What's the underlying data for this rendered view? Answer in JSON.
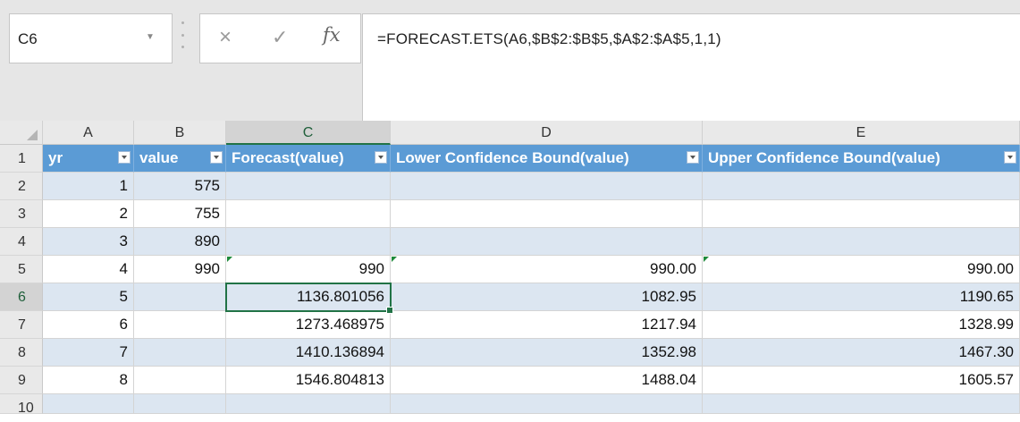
{
  "name_box": {
    "value": "C6"
  },
  "formula_bar": {
    "cancel_icon": "×",
    "enter_icon": "✓",
    "fx_label": "fx",
    "formula": "=FORECAST.ETS(A6,$B$2:$B$5,$A$2:$A$5,1,1)"
  },
  "grid": {
    "columns": [
      "A",
      "B",
      "C",
      "D",
      "E"
    ],
    "selected_column": "C",
    "header_row": {
      "number": "1",
      "cells": [
        "yr",
        "value",
        "Forecast(value)",
        "Lower Confidence Bound(value)",
        "Upper Confidence Bound(value)"
      ]
    },
    "rows": [
      {
        "number": "2",
        "cells": [
          "1",
          "575",
          "",
          "",
          ""
        ]
      },
      {
        "number": "3",
        "cells": [
          "2",
          "755",
          "",
          "",
          ""
        ]
      },
      {
        "number": "4",
        "cells": [
          "3",
          "890",
          "",
          "",
          ""
        ]
      },
      {
        "number": "5",
        "cells": [
          "4",
          "990",
          "990",
          "990.00",
          "990.00"
        ]
      },
      {
        "number": "6",
        "cells": [
          "5",
          "",
          "1136.801056",
          "1082.95",
          "1190.65"
        ]
      },
      {
        "number": "7",
        "cells": [
          "6",
          "",
          "1273.468975",
          "1217.94",
          "1328.99"
        ]
      },
      {
        "number": "8",
        "cells": [
          "7",
          "",
          "1410.136894",
          "1352.98",
          "1467.30"
        ]
      },
      {
        "number": "9",
        "cells": [
          "8",
          "",
          "1546.804813",
          "1488.04",
          "1605.57"
        ]
      },
      {
        "number": "10",
        "cells": [
          "",
          "",
          "",
          "",
          ""
        ]
      }
    ],
    "selected_cell": "C6"
  },
  "colors": {
    "table_header": "#5b9bd5",
    "band": "#dce6f1",
    "selection": "#217346"
  }
}
